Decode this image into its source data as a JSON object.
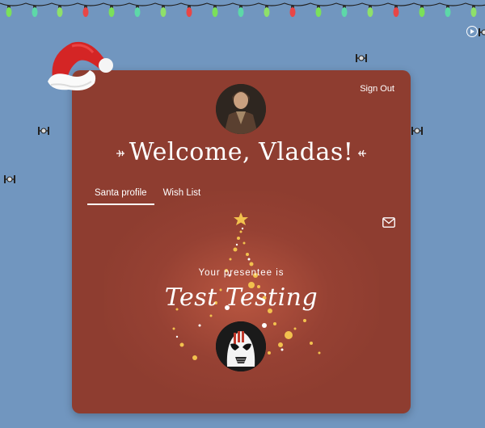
{
  "header": {
    "sign_out_label": "Sign Out"
  },
  "welcome": {
    "title": "Welcome, Vladas!"
  },
  "tabs": [
    {
      "label": "Santa profile",
      "active": true
    },
    {
      "label": "Wish List",
      "active": false
    }
  ],
  "presentee": {
    "label": "Your presentee is",
    "name": "Test Testing"
  },
  "icons": {
    "lights": "christmas-lights-icon",
    "play": "play-icon",
    "hat": "santa-hat-icon",
    "mail": "mail-icon",
    "tree": "christmas-tree-icon",
    "tie_fighter": "tie-fighter-icon"
  },
  "colors": {
    "background": "#7196bf",
    "card": "#8e3d30",
    "accent_gold": "#f2c14e",
    "text": "#ffffff"
  }
}
